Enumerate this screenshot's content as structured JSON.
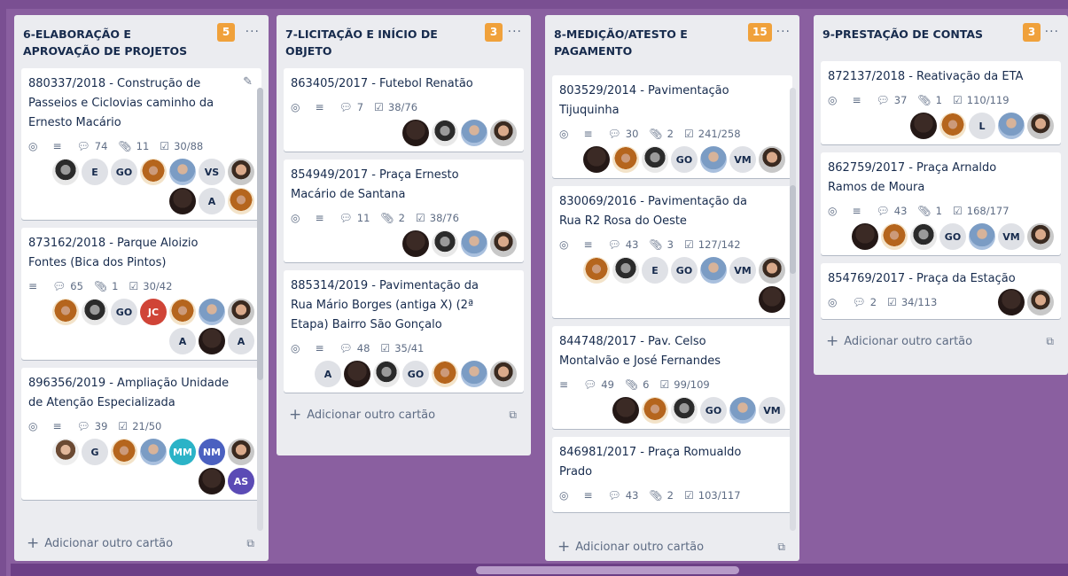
{
  "colors": {
    "board_bg": "#8a5fa0",
    "badge": "#f0a13b",
    "list_bg": "#ebecf0"
  },
  "lists": [
    {
      "title": "6-ELABORAÇÃO E APROVAÇÃO DE PROJETOS",
      "count": "5",
      "menu": "···",
      "cards": [
        {
          "title": "880337/2018 - Construção de Passeios e Ciclovias caminho da Ernesto Macário",
          "badges": {
            "watch": true,
            "desc": true,
            "comments": "74",
            "attachments": "11",
            "checklist": "30/88"
          },
          "members": [
            "E",
            "GO",
            "VS",
            "A"
          ]
        },
        {
          "title": "873162/2018 - Parque Aloizio Fontes (Bica dos Pintos)",
          "badges": {
            "watch": false,
            "desc": true,
            "comments": "65",
            "attachments": "1",
            "checklist": "30/42"
          },
          "members": [
            "GO",
            "JC",
            "A",
            "A"
          ]
        },
        {
          "title": "896356/2019 - Ampliação Unidade de Atenção Especializada",
          "badges": {
            "watch": true,
            "desc": true,
            "comments": "39",
            "attachments": "",
            "checklist": "21/50"
          },
          "members": [
            "G",
            "MM",
            "NM",
            "AS"
          ]
        }
      ],
      "add_label": "Adicionar outro cartão"
    },
    {
      "title": "7-LICITAÇÃO E INÍCIO DE OBJETO",
      "count": "3",
      "menu": "···",
      "cards": [
        {
          "title": "863405/2017 - Futebol Renatão",
          "badges": {
            "watch": true,
            "desc": true,
            "comments": "7",
            "attachments": "",
            "checklist": "38/76"
          }
        },
        {
          "title": "854949/2017 - Praça Ernesto Macário de Santana",
          "badges": {
            "watch": true,
            "desc": true,
            "comments": "11",
            "attachments": "2",
            "checklist": "38/76"
          }
        },
        {
          "title": "885314/2019 - Pavimentação da Rua Mário Borges (antiga X) (2ª Etapa) Bairro São Gonçalo",
          "badges": {
            "watch": true,
            "desc": true,
            "comments": "48",
            "attachments": "",
            "checklist": "35/41"
          },
          "members": [
            "A",
            "GO"
          ]
        }
      ],
      "add_label": "Adicionar outro cartão"
    },
    {
      "title": "8-MEDIÇÃO/ATESTO E PAGAMENTO",
      "count": "15",
      "menu": "···",
      "cards": [
        {
          "title": "803529/2014 - Pavimentação Tijuquinha",
          "badges": {
            "watch": true,
            "desc": true,
            "comments": "30",
            "attachments": "2",
            "checklist": "241/258"
          },
          "members": [
            "GO",
            "VM"
          ]
        },
        {
          "title": "830069/2016 - Pavimentação da Rua R2 Rosa do Oeste",
          "badges": {
            "watch": true,
            "desc": true,
            "comments": "43",
            "attachments": "3",
            "checklist": "127/142"
          },
          "members": [
            "E",
            "GO",
            "VM"
          ]
        },
        {
          "title": "844748/2017 - Pav. Celso Montalvão e José Fernandes",
          "badges": {
            "watch": false,
            "desc": true,
            "comments": "49",
            "attachments": "6",
            "checklist": "99/109"
          },
          "members": [
            "GO",
            "VM"
          ]
        },
        {
          "title": "846981/2017 - Praça Romualdo Prado",
          "badges": {
            "watch": true,
            "desc": true,
            "comments": "43",
            "attachments": "2",
            "checklist": "103/117"
          }
        }
      ],
      "add_label": "Adicionar outro cartão"
    },
    {
      "title": "9-PRESTAÇÃO DE CONTAS",
      "count": "3",
      "menu": "···",
      "cards": [
        {
          "title": "872137/2018 - Reativação da ETA",
          "badges": {
            "watch": true,
            "desc": true,
            "comments": "37",
            "attachments": "1",
            "checklist": "110/119"
          },
          "members": [
            "L"
          ]
        },
        {
          "title": "862759/2017 - Praça Arnaldo Ramos de Moura",
          "badges": {
            "watch": true,
            "desc": true,
            "comments": "43",
            "attachments": "1",
            "checklist": "168/177"
          },
          "members": [
            "GO",
            "VM"
          ]
        },
        {
          "title": "854769/2017 - Praça da Estação",
          "badges": {
            "watch": true,
            "desc": false,
            "comments": "2",
            "attachments": "",
            "checklist": "34/113"
          }
        }
      ],
      "add_label": "Adicionar outro cartão"
    }
  ]
}
